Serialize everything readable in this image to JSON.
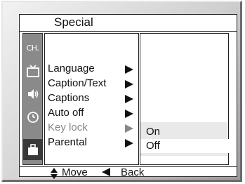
{
  "title": "Special",
  "sidebar": {
    "items": [
      {
        "icon": "ch-icon",
        "label": "CH."
      },
      {
        "icon": "tv-icon"
      },
      {
        "icon": "speaker-icon"
      },
      {
        "icon": "clock-icon"
      },
      {
        "icon": "briefcase-icon",
        "active": true
      }
    ]
  },
  "menu": {
    "items": [
      {
        "label": "Language"
      },
      {
        "label": "Caption/Text"
      },
      {
        "label": "Captions"
      },
      {
        "label": "Auto off"
      },
      {
        "label": "Key lock",
        "highlighted": true
      },
      {
        "label": "Parental"
      }
    ]
  },
  "options": {
    "items": [
      {
        "label": "On"
      },
      {
        "label": "Off",
        "selected": true
      }
    ]
  },
  "footer": {
    "move_label": "Move",
    "back_label": "Back"
  }
}
